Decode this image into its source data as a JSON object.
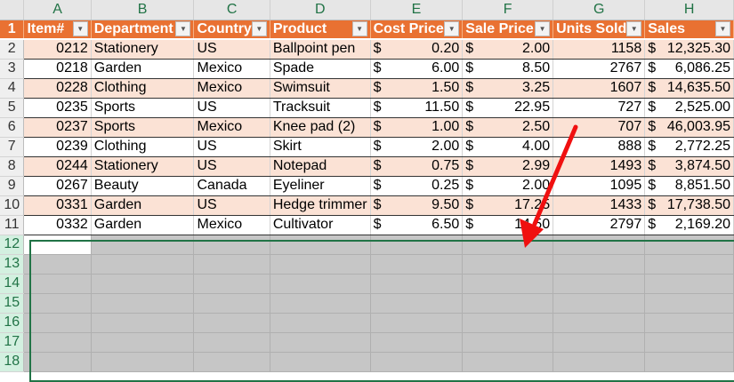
{
  "columns": [
    "A",
    "B",
    "C",
    "D",
    "E",
    "F",
    "G",
    "H"
  ],
  "headers": [
    "Item#",
    "Department",
    "Country",
    "Product",
    "Cost Price",
    "Sale Price",
    "Units Sold",
    "Sales"
  ],
  "currency_symbol": "$",
  "rows": [
    {
      "item": "0212",
      "department": "Stationery",
      "country": "US",
      "product": "Ballpoint pen",
      "cost": "0.20",
      "sale": "2.00",
      "units": "1158",
      "sales": "12,325.30"
    },
    {
      "item": "0218",
      "department": "Garden",
      "country": "Mexico",
      "product": "Spade",
      "cost": "6.00",
      "sale": "8.50",
      "units": "2767",
      "sales": "6,086.25"
    },
    {
      "item": "0228",
      "department": "Clothing",
      "country": "Mexico",
      "product": "Swimsuit",
      "cost": "1.50",
      "sale": "3.25",
      "units": "1607",
      "sales": "14,635.50"
    },
    {
      "item": "0235",
      "department": "Sports",
      "country": "US",
      "product": "Tracksuit",
      "cost": "11.50",
      "sale": "22.95",
      "units": "727",
      "sales": "2,525.00"
    },
    {
      "item": "0237",
      "department": "Sports",
      "country": "Mexico",
      "product": "Knee pad (2)",
      "cost": "1.00",
      "sale": "2.50",
      "units": "707",
      "sales": "46,003.95"
    },
    {
      "item": "0239",
      "department": "Clothing",
      "country": "US",
      "product": "Skirt",
      "cost": "2.00",
      "sale": "4.00",
      "units": "888",
      "sales": "2,772.25"
    },
    {
      "item": "0244",
      "department": "Stationery",
      "country": "US",
      "product": "Notepad",
      "cost": "0.75",
      "sale": "2.99",
      "units": "1493",
      "sales": "3,874.50"
    },
    {
      "item": "0267",
      "department": "Beauty",
      "country": "Canada",
      "product": "Eyeliner",
      "cost": "0.25",
      "sale": "2.00",
      "units": "1095",
      "sales": "8,851.50"
    },
    {
      "item": "0331",
      "department": "Garden",
      "country": "US",
      "product": "Hedge trimmer",
      "cost": "9.50",
      "sale": "17.25",
      "units": "1433",
      "sales": "17,738.50"
    },
    {
      "item": "0332",
      "department": "Garden",
      "country": "Mexico",
      "product": "Cultivator",
      "cost": "6.50",
      "sale": "14.50",
      "units": "2797",
      "sales": "2,169.20"
    }
  ],
  "row_numbers": [
    "1",
    "2",
    "3",
    "4",
    "5",
    "6",
    "7",
    "8",
    "9",
    "10",
    "11",
    "12",
    "13",
    "14",
    "15",
    "16",
    "17",
    "18"
  ],
  "colors": {
    "header": "#e97132",
    "band": "#fbe2d5",
    "selection": "#217346",
    "arrow": "#f01010"
  }
}
